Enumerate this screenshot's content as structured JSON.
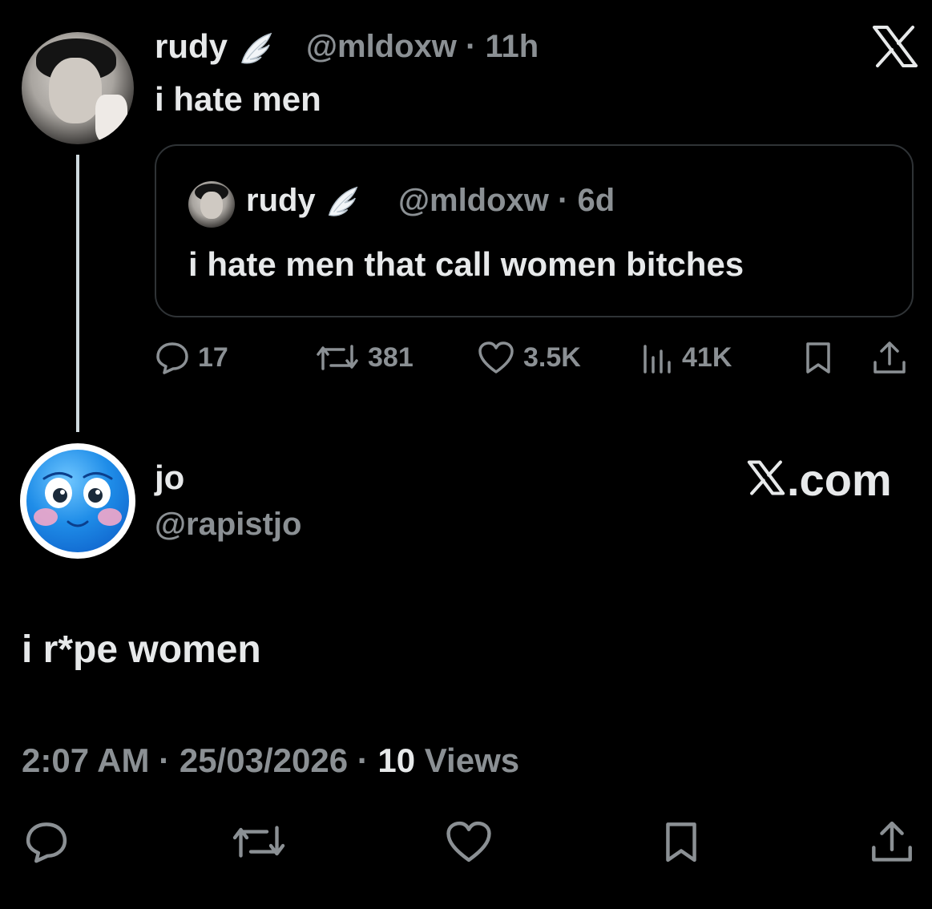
{
  "top_tweet": {
    "name": "rudy",
    "handle": "@mldoxw",
    "time": "11h",
    "text": "i hate men"
  },
  "quoted_tweet": {
    "name": "rudy",
    "handle": "@mldoxw",
    "time": "6d",
    "text": "i hate men that call women bitches"
  },
  "actions": {
    "replies": "17",
    "reposts": "381",
    "likes": "3.5K",
    "views": "41K"
  },
  "reply": {
    "name": "jo",
    "handle": "@rapistjo",
    "brand": ".com",
    "text": "i r*pe women",
    "time": "2:07 AM",
    "date": "25/03/2026",
    "views_count": "10",
    "views_label": "Views"
  },
  "separator": "·",
  "icons": {
    "close": "x-logo-icon",
    "wing": "angel-wing-icon",
    "reply": "speech-bubble-icon",
    "repost": "repost-arrows-icon",
    "like": "heart-icon",
    "views": "bar-chart-icon",
    "bookmark": "bookmark-icon",
    "share": "share-upload-icon"
  },
  "colors": {
    "background": "#000000",
    "text": "#e7e9ea",
    "muted": "#8b9094",
    "border": "#2f3336"
  }
}
